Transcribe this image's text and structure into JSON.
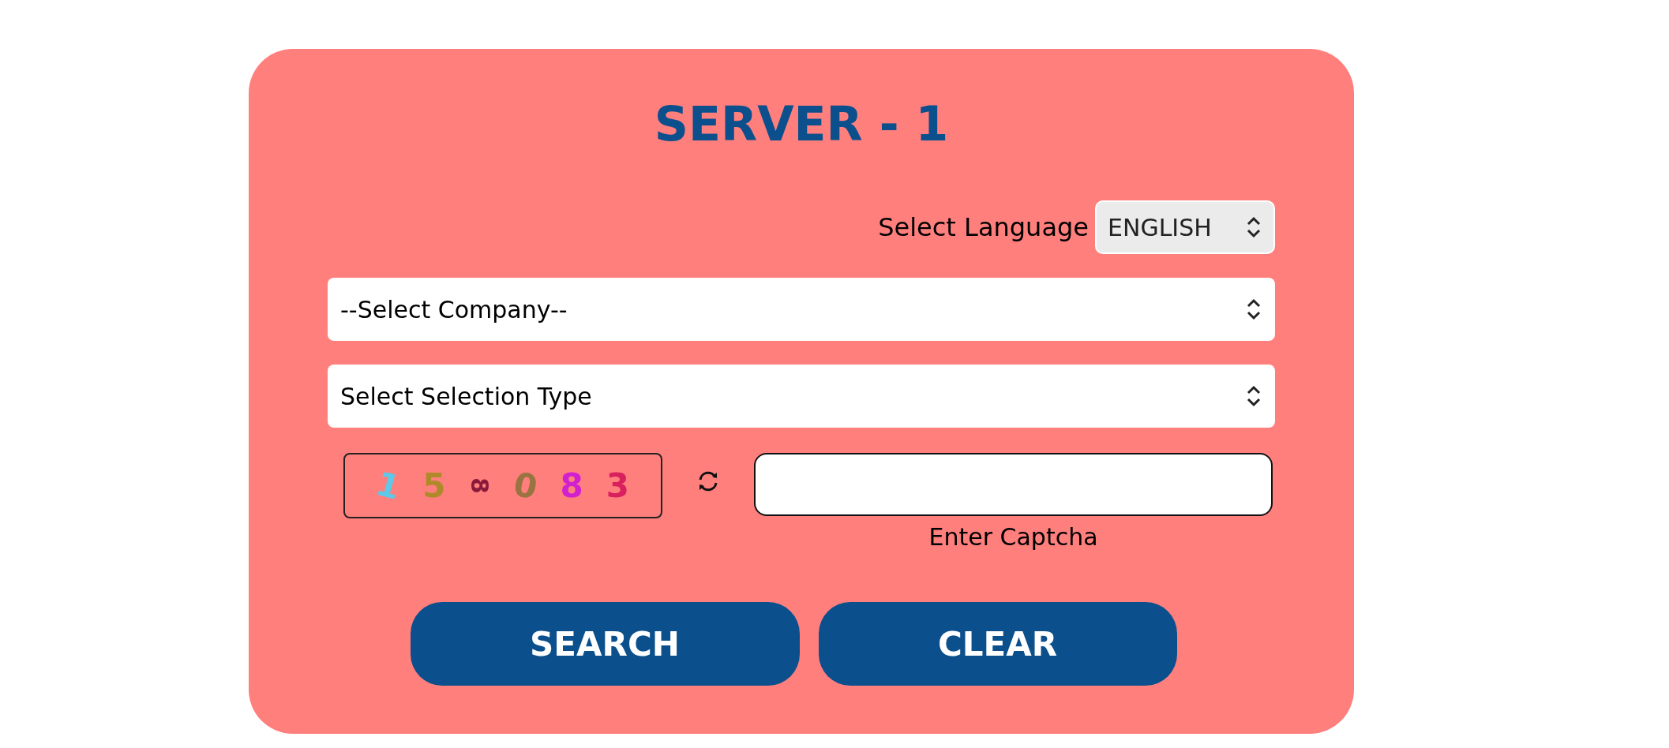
{
  "title": "SERVER - 1",
  "language": {
    "label": "Select Language",
    "value": "ENGLISH"
  },
  "selects": [
    {
      "value": "--Select Company--"
    },
    {
      "value": "Select Selection Type"
    }
  ],
  "captcha": {
    "characters": [
      {
        "text": "1",
        "color": "#5ec8e8"
      },
      {
        "text": "5",
        "color": "#b08a2a"
      },
      {
        "text": "8",
        "color": "#8a1a3a"
      },
      {
        "text": "0",
        "color": "#9a7440"
      },
      {
        "text": "8",
        "color": "#d020d0"
      },
      {
        "text": "3",
        "color": "#d8205e"
      }
    ],
    "input_label": "Enter Captcha"
  },
  "buttons": [
    "SEARCH",
    "CLEAR"
  ]
}
